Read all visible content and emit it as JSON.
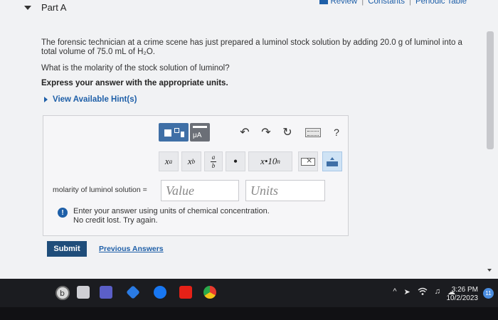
{
  "header": {
    "part_title": "Part A",
    "links": [
      "Review",
      "Constants",
      "Periodic Table"
    ]
  },
  "question": {
    "text": "The forensic technician at a crime scene has just prepared a luminol stock solution by adding 20.0 g of luminol into a total volume of 75.0 mL of H₂O.",
    "prompt": "What is the molarity of the stock solution of luminol?",
    "instruction": "Express your answer with the appropriate units."
  },
  "hints": {
    "label": "View Available Hint(s)"
  },
  "toolbar": {
    "units_label": "μA",
    "undo_symbol": "↶",
    "redo_symbol": "↷",
    "reset_symbol": "↻",
    "help_symbol": "?",
    "keys": {
      "superscript": "x",
      "superscript_exp": "a",
      "subscript": "x",
      "subscript_idx": "b",
      "fraction_num": "a",
      "fraction_den": "b",
      "dot": "•",
      "sci_notation": "x•10",
      "sci_exp": "n"
    }
  },
  "answer": {
    "label": "molarity of luminol solution =",
    "value_placeholder": "Value",
    "units_placeholder": "Units"
  },
  "feedback": {
    "icon": "!",
    "line1": "Enter your answer using units of chemical concentration.",
    "line2": "No credit lost. Try again."
  },
  "actions": {
    "submit_label": "Submit",
    "previous_answers_label": "Previous Answers"
  },
  "taskbar": {
    "time": "3:26 PM",
    "date": "10/2/2023",
    "notification_count": "11",
    "tray_symbols": [
      "^",
      "➤",
      "wifi",
      "♫",
      "☁"
    ]
  },
  "colors": {
    "link_blue": "#1e5fa8",
    "submit_bg": "#1f4d7a",
    "toolbar_blue": "#3f6fa6"
  }
}
